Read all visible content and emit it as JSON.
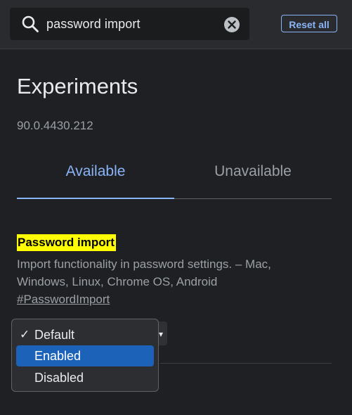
{
  "search": {
    "query": "password import",
    "search_icon": "search-icon",
    "clear_icon": "clear-icon"
  },
  "header": {
    "reset_label": "Reset all"
  },
  "main": {
    "title": "Experiments",
    "version": "90.0.4430.212",
    "tabs": [
      {
        "label": "Available",
        "active": true
      },
      {
        "label": "Unavailable",
        "active": false
      }
    ]
  },
  "flag": {
    "name": "Password import",
    "description": "Import functionality in password settings. – Mac, Windows, Linux, Chrome OS, Android",
    "link": "#PasswordImport",
    "dropdown": {
      "checked_mark": "✓",
      "options": [
        {
          "label": "Default",
          "checked": true,
          "highlighted": false
        },
        {
          "label": "Enabled",
          "checked": false,
          "highlighted": true
        },
        {
          "label": "Disabled",
          "checked": false,
          "highlighted": false
        }
      ]
    }
  },
  "colors": {
    "background": "#1f2023",
    "accent": "#8ab4f8",
    "highlight": "#ffff00",
    "selection": "#1c62b9"
  }
}
